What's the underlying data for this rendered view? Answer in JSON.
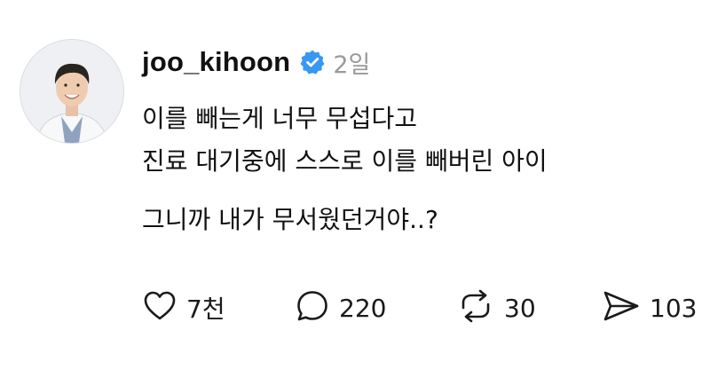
{
  "post": {
    "username": "joo_kihoon",
    "time": "2일",
    "lines": [
      "이를 빼는게 너무 무섭다고",
      "진료 대기중에 스스로 이를 빼버린 아이",
      "그니까 내가 무서웠던거야..?"
    ]
  },
  "actions": {
    "likes": "7천",
    "replies": "220",
    "reposts": "30",
    "shares": "103"
  },
  "colors": {
    "verified": "#3897f0",
    "text": "#111111",
    "muted": "#9a9a9a"
  },
  "icons": [
    "heart-icon",
    "comment-icon",
    "repost-icon",
    "share-icon",
    "verified-badge-icon"
  ]
}
